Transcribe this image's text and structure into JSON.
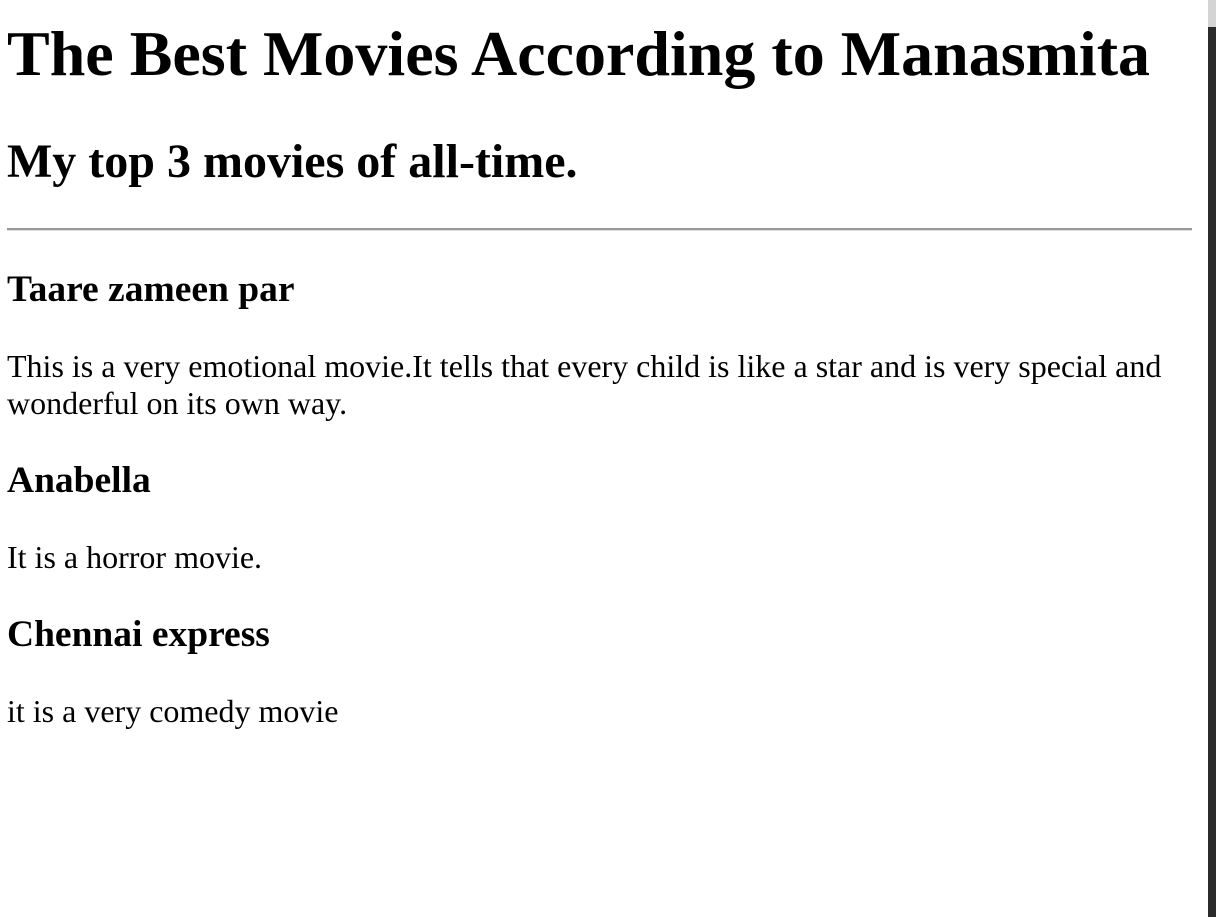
{
  "title": "The Best Movies According to Manasmita",
  "subtitle": "My top 3 movies of all-time.",
  "movies": [
    {
      "name": "Taare zameen par",
      "description": "This is a very emotional movie.It tells that every child is like a star and is very special and wonderful on its own way."
    },
    {
      "name": "Anabella",
      "description": "It is a horror movie."
    },
    {
      "name": "Chennai express",
      "description": "it is a very comedy movie"
    }
  ]
}
